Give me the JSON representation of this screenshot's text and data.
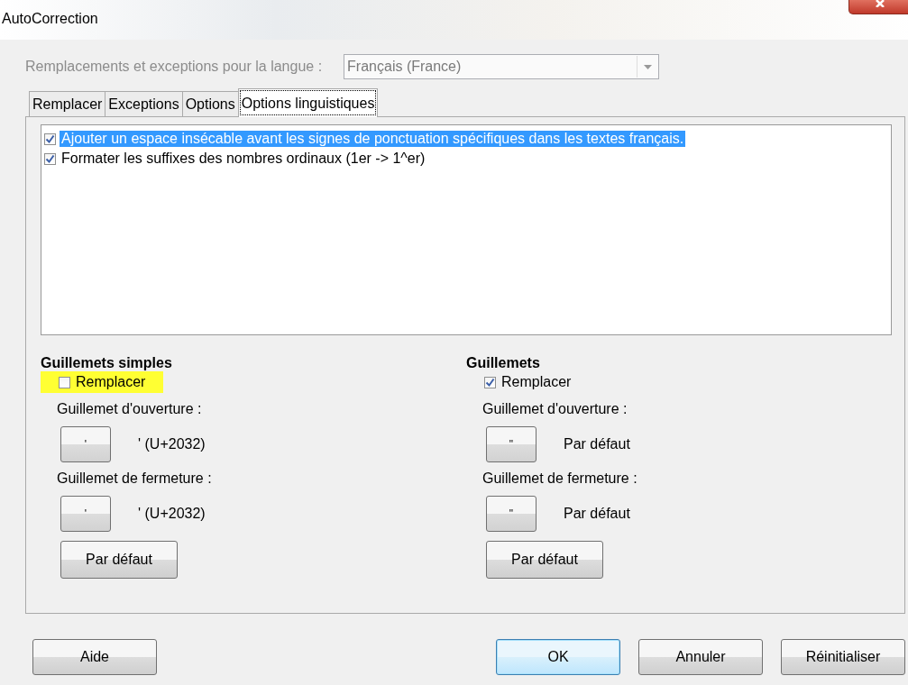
{
  "window": {
    "title": "AutoCorrection"
  },
  "language": {
    "label": "Remplacements et exceptions pour la langue :",
    "value": "Français (France)",
    "disabled": true
  },
  "tabs": [
    {
      "label": "Remplacer",
      "selected": false
    },
    {
      "label": "Exceptions",
      "selected": false
    },
    {
      "label": "Options",
      "selected": false
    },
    {
      "label": "Options linguistiques",
      "selected": true
    }
  ],
  "options": [
    {
      "label": "Ajouter un espace insécable avant les signes de ponctuation spécifiques dans les textes français.",
      "checked": true,
      "selected": true
    },
    {
      "label": "Formater les suffixes des nombres ordinaux (1er -> 1^er)",
      "checked": true,
      "selected": false
    }
  ],
  "quote_groups": [
    {
      "title": "Guillemets simples",
      "replace": {
        "label": "Remplacer",
        "checked": false,
        "highlighted": true
      },
      "opening": {
        "label": "Guillemet d'ouverture :",
        "char": "'",
        "description": "' (U+2032)"
      },
      "closing": {
        "label": "Guillemet de fermeture :",
        "char": "'",
        "description": "' (U+2032)"
      },
      "default_button": "Par défaut"
    },
    {
      "title": "Guillemets",
      "replace": {
        "label": "Remplacer",
        "checked": true,
        "highlighted": false
      },
      "opening": {
        "label": "Guillemet d'ouverture :",
        "char": "\"",
        "description": "Par défaut"
      },
      "closing": {
        "label": "Guillemet de fermeture :",
        "char": "\"",
        "description": "Par défaut"
      },
      "default_button": "Par défaut"
    }
  ],
  "buttons": [
    {
      "label": "Aide",
      "default": false
    },
    {
      "label": "OK",
      "default": true
    },
    {
      "label": "Annuler",
      "default": false
    },
    {
      "label": "Réinitialiser",
      "default": false
    }
  ]
}
